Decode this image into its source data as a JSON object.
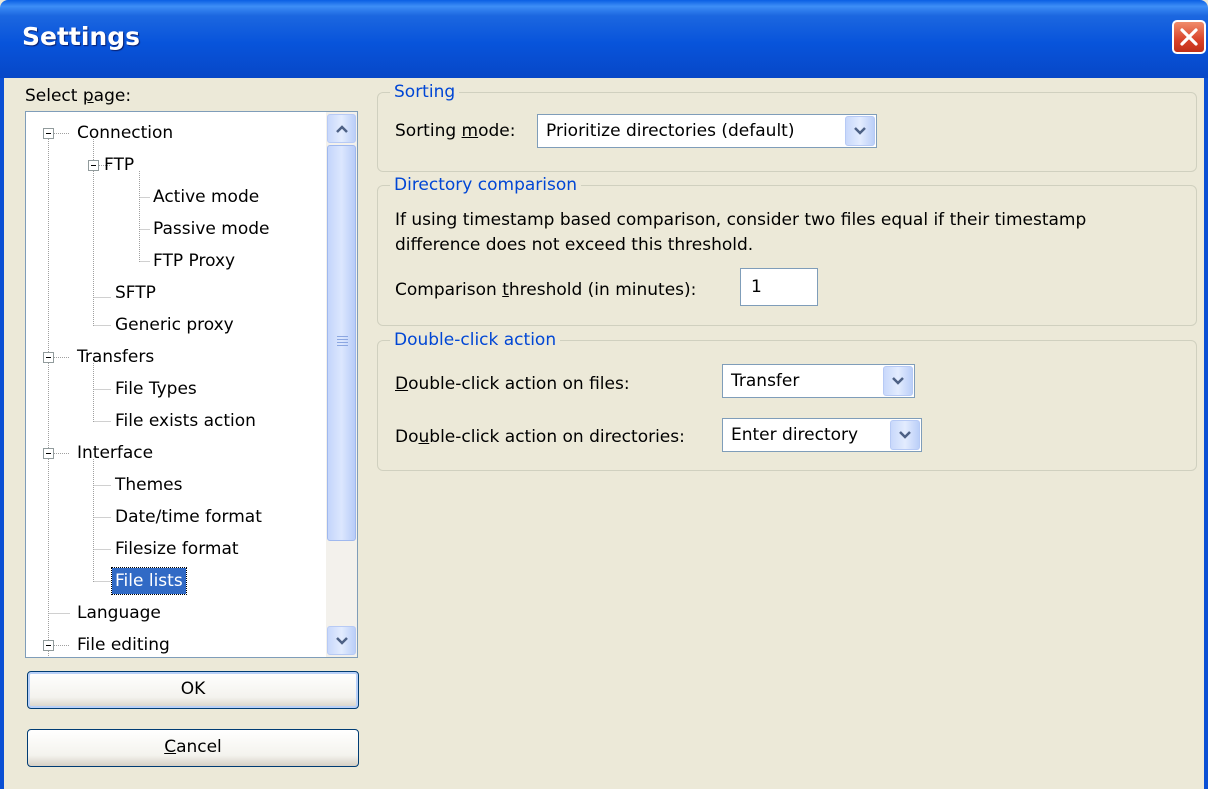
{
  "window": {
    "title": "Settings"
  },
  "sidebar": {
    "select_page_label_pre": "Select ",
    "select_page_label_ul": "p",
    "select_page_label_post": "age:",
    "tree": [
      {
        "label": "Connection"
      },
      {
        "label": "FTP"
      },
      {
        "label": "Active mode"
      },
      {
        "label": "Passive mode"
      },
      {
        "label": "FTP Proxy"
      },
      {
        "label": "SFTP"
      },
      {
        "label": "Generic proxy"
      },
      {
        "label": "Transfers"
      },
      {
        "label": "File Types"
      },
      {
        "label": "File exists action"
      },
      {
        "label": "Interface"
      },
      {
        "label": "Themes"
      },
      {
        "label": "Date/time format"
      },
      {
        "label": "Filesize format"
      },
      {
        "label": "File lists"
      },
      {
        "label": "Language"
      },
      {
        "label": "File editing"
      }
    ],
    "selected": "File lists"
  },
  "buttons": {
    "ok": "OK",
    "cancel_ul": "C",
    "cancel_rest": "ancel"
  },
  "sorting": {
    "legend": "Sorting",
    "label_pre": "Sorting ",
    "label_ul": "m",
    "label_post": "ode:",
    "value": "Prioritize directories (default)"
  },
  "directory_comparison": {
    "legend": "Directory comparison",
    "description_line1": "If using timestamp based comparison, consider two files equal if their timestamp",
    "description_line2": "difference does not exceed this threshold.",
    "threshold_label_pre": "Comparison ",
    "threshold_label_ul": "t",
    "threshold_label_post": "hreshold (in minutes):",
    "threshold_value": "1"
  },
  "double_click": {
    "legend": "Double-click action",
    "files_label_ul": "D",
    "files_label_rest": "ouble-click action on files:",
    "files_value": "Transfer",
    "dirs_label_pre": "Do",
    "dirs_label_ul": "u",
    "dirs_label_post": "ble-click action on directories:",
    "dirs_value": "Enter directory"
  },
  "colors": {
    "titlebar": "#0854DB",
    "group_legend": "#0046D5",
    "selection": "#316AC5",
    "face": "#ECE9D8"
  }
}
